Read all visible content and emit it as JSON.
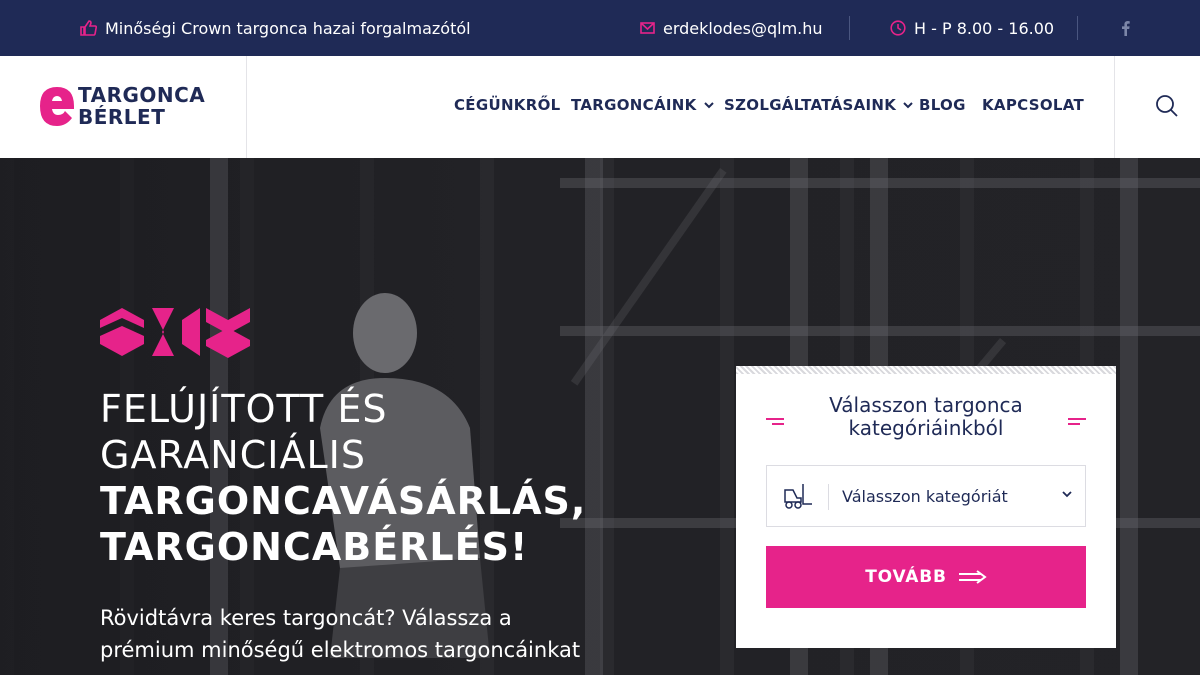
{
  "topbar": {
    "promo": "Minőségi Crown targonca hazai forgalmazótól",
    "email": "erdeklodes@qlm.hu",
    "hours": "H - P 8.00 - 16.00"
  },
  "logo": {
    "line1": "TARGONCA",
    "line2": "BÉRLET"
  },
  "nav": [
    {
      "label": "CÉGÜNKRŐL"
    },
    {
      "label": "TARGONCÁINK"
    },
    {
      "label": "SZOLGÁLTATÁSAINK"
    },
    {
      "label": "BLOG"
    },
    {
      "label": "KAPCSOLAT"
    }
  ],
  "hero": {
    "line1": "FELÚJÍTOTT ÉS",
    "line2": "GARANCIÁLIS",
    "line3": "TARGONCAVÁSÁRLÁS,",
    "line4": "TARGONCABÉRLÉS!",
    "paragraph": "Rövidtávra keres targoncát? Válassza a prémium minőségű elektromos targoncáinkat"
  },
  "card": {
    "title": "Válasszon targonca kategóriáinkból",
    "select_value": "Válasszon kategóriát",
    "button_label": "TOVÁBB"
  },
  "colors": {
    "navy": "#1f2a56",
    "pink": "#e6238a"
  },
  "icons": [
    "thumbs-up-icon",
    "mail-icon",
    "clock-icon",
    "facebook-icon",
    "search-icon",
    "chevron-down-icon",
    "forklift-icon",
    "arrow-right-icon"
  ]
}
